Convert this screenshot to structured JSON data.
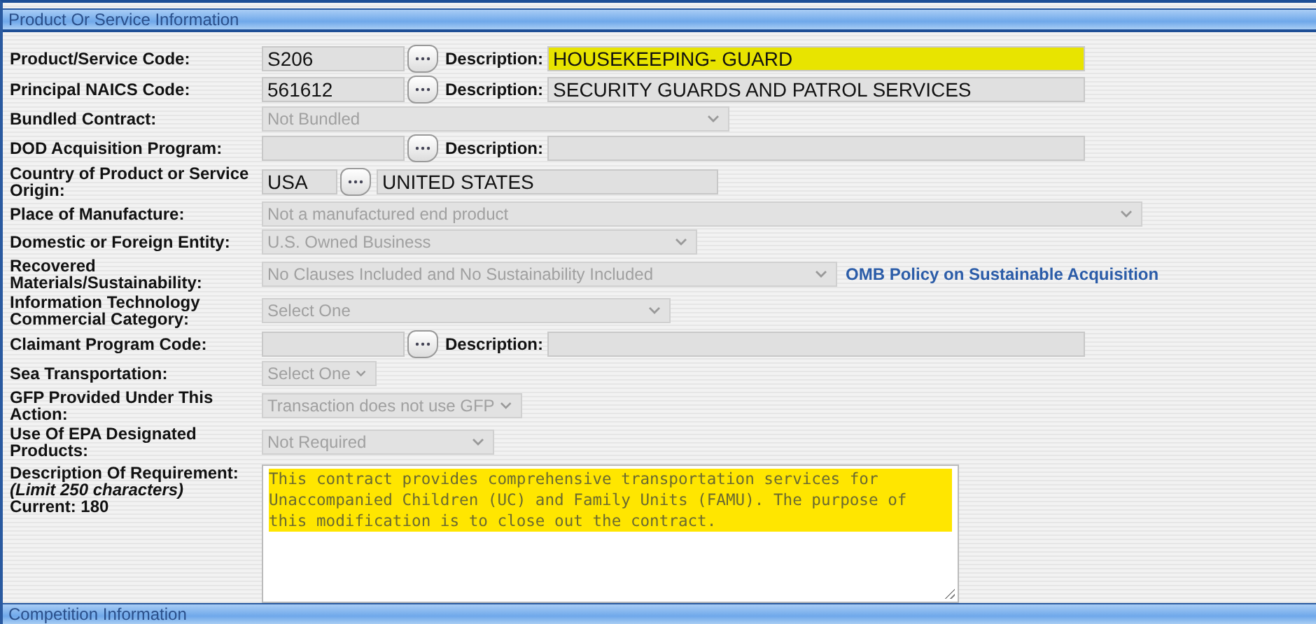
{
  "section": {
    "title": "Product Or Service Information"
  },
  "rows": [
    {
      "kind": "lookup",
      "label": "Product/Service Code:",
      "code": "S206",
      "desc_label": "Description:",
      "description": "HOUSEKEEPING- GUARD",
      "highlighted": true
    },
    {
      "kind": "lookup",
      "label": "Principal NAICS Code:",
      "code": "561612",
      "desc_label": "Description:",
      "description": "SECURITY GUARDS AND PATROL SERVICES",
      "highlighted": false
    },
    {
      "kind": "select",
      "label": "Bundled Contract:",
      "value": "Not Bundled",
      "disabled": true
    },
    {
      "kind": "lookup",
      "label": "DOD Acquisition Program:",
      "desc_label": "Description:",
      "highlighted": false
    },
    {
      "kind": "country",
      "label": "Country of Product or Service Origin:",
      "code": "USA",
      "description": "UNITED STATES"
    },
    {
      "kind": "select",
      "label": "Place of Manufacture:",
      "value": "Not a manufactured end product",
      "disabled": true
    },
    {
      "kind": "select",
      "label": "Domestic or Foreign Entity:",
      "value": "U.S. Owned Business",
      "disabled": true
    },
    {
      "kind": "select",
      "label": "Recovered Materials/Sustainability:",
      "value": "No Clauses Included and No Sustainability Included",
      "disabled": true,
      "link": "OMB Policy on Sustainable Acquisition"
    },
    {
      "kind": "select",
      "label": "Information Technology Commercial Category:",
      "value": "Select One",
      "disabled": true
    },
    {
      "kind": "lookup",
      "label": "Claimant Program Code:",
      "desc_label": "Description:",
      "highlighted": false
    },
    {
      "kind": "select",
      "label": "Sea Transportation:",
      "value": "Select One",
      "disabled": true
    },
    {
      "kind": "select",
      "label": "GFP Provided Under This Action:",
      "value": "Transaction does not use GFP",
      "disabled": true
    },
    {
      "kind": "select",
      "label": "Use Of EPA Designated Products:",
      "value": "Not Required",
      "disabled": true
    }
  ],
  "requirement": {
    "label": "Description Of Requirement:",
    "limit": "(Limit 250 characters)",
    "current": "Current: 180",
    "value": "This contract provides comprehensive transportation services for Unaccompanied Children (UC) and Family Units (FAMU). The purpose of this modification is to close out the contract.",
    "highlighted": true
  },
  "next_section": {
    "title": "Competition Information"
  }
}
